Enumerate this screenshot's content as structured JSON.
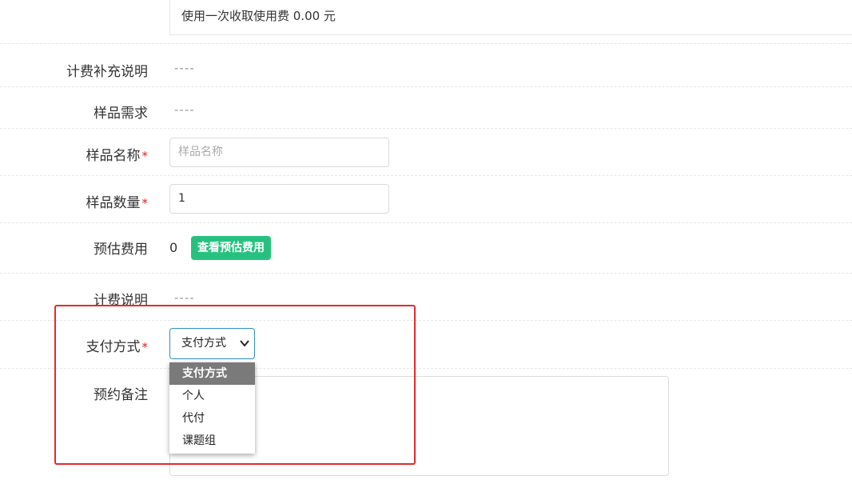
{
  "top_note": "使用一次收取使用费 0.00 元",
  "fields": {
    "billing_supplement": {
      "label": "计费补充说明",
      "value": "----"
    },
    "sample_requirement": {
      "label": "样品需求",
      "value": "----"
    },
    "sample_name": {
      "label": "样品名称",
      "required_mark": "*",
      "placeholder": "样品名称",
      "value": ""
    },
    "sample_quantity": {
      "label": "样品数量",
      "required_mark": "*",
      "value": "1"
    },
    "estimated_cost": {
      "label": "预估费用",
      "value": "0",
      "button_label": "查看预估费用"
    },
    "billing_note": {
      "label": "计费说明",
      "value": "----"
    },
    "payment_method": {
      "label": "支付方式",
      "required_mark": "*",
      "selected": "支付方式",
      "options": [
        "支付方式",
        "个人",
        "代付",
        "课题组"
      ],
      "highlighted_index": 0
    },
    "booking_remark": {
      "label": "预约备注",
      "value": ""
    }
  },
  "colors": {
    "accent_green": "#27c17f",
    "required_red": "#e02020",
    "highlight_red": "#e52a2a",
    "select_border": "#2f8fc8"
  },
  "icons": {
    "select_arrow": "chevron-down-icon"
  }
}
